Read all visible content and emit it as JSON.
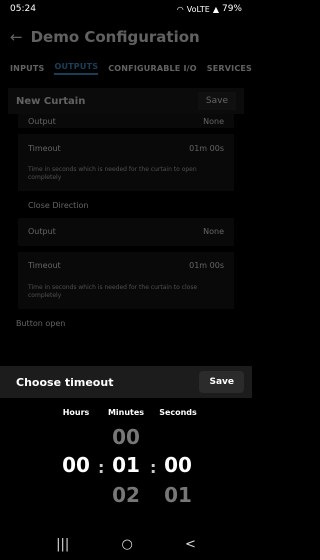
{
  "statusbar": {
    "time": "05:24",
    "signal": "VoLTE",
    "battery": "79%"
  },
  "app": {
    "title": "Demo Configuration",
    "tabs": [
      "INPUTS",
      "OUTPUTS",
      "CONFIGURABLE I/O",
      "SERVICES"
    ],
    "active_tab": "OUTPUTS",
    "card": {
      "name": "New Curtain",
      "save_label": "Save"
    },
    "open_section": {
      "output_label": "Output",
      "output_value": "None",
      "timeout_label": "Timeout",
      "timeout_value": "01m 00s",
      "hint": "Time in seconds which is needed for the curtain to open completely"
    },
    "close_section": {
      "label": "Close Direction",
      "output_label": "Output",
      "output_value": "None",
      "timeout_label": "Timeout",
      "timeout_value": "01m 00s",
      "hint": "Time in seconds which is needed for the curtain to close completely"
    },
    "button_open_label": "Button open"
  },
  "sheet": {
    "title": "Choose timeout",
    "save_label": "Save",
    "hours": {
      "label": "Hours",
      "prev": "",
      "current": "00",
      "next": ""
    },
    "minutes": {
      "label": "Minutes",
      "prev": "00",
      "current": "01",
      "next": "02"
    },
    "seconds": {
      "label": "Seconds",
      "prev": "",
      "current": "00",
      "next": "01"
    },
    "separator": ":"
  },
  "navbar": {
    "recents": "|||",
    "home": "○",
    "back": "<"
  },
  "colors": {
    "accent": "#4aa3df",
    "sheet_header": "#1c1c1c"
  }
}
